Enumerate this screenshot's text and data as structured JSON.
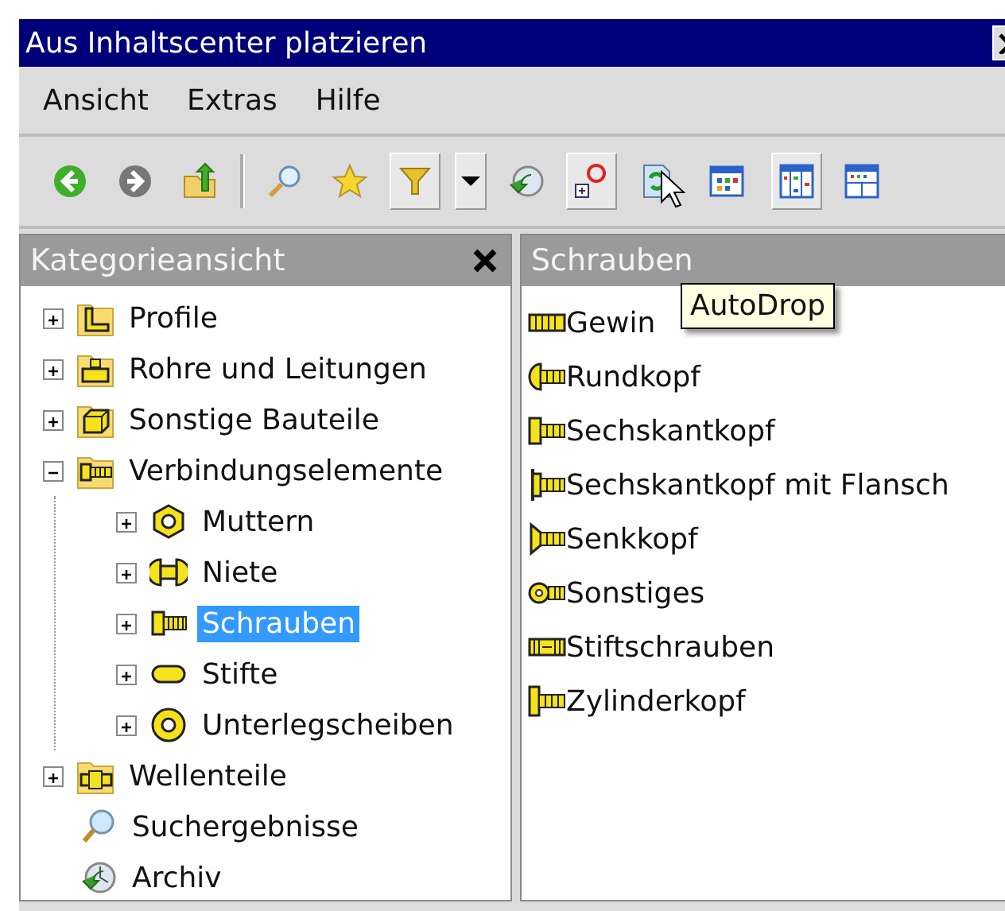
{
  "window": {
    "title": "Aus Inhaltscenter platzieren"
  },
  "menu": [
    "Ansicht",
    "Extras",
    "Hilfe"
  ],
  "toolbar": [
    {
      "pressed": false
    },
    {
      "pressed": false
    },
    {
      "pressed": false
    },
    {
      "kind": "separator"
    },
    {
      "pressed": false
    },
    {
      "pressed": false
    },
    {
      "pressed": true
    },
    {
      "pressed": true
    },
    {
      "pressed": false
    },
    {
      "pressed": true
    },
    {
      "pressed": false
    },
    {
      "pressed": false
    },
    {
      "pressed": true
    },
    {
      "pressed": false
    }
  ],
  "tooltip": "AutoDrop",
  "category_panel": {
    "title": "Kategorieansicht",
    "tree": [
      {
        "label": "Profile",
        "expanded": false,
        "selected": false
      },
      {
        "label": "Rohre und Leitungen",
        "expanded": false,
        "selected": false
      },
      {
        "label": "Sonstige Bauteile",
        "expanded": false,
        "selected": false
      },
      {
        "label": "Verbindungselemente",
        "expanded": true,
        "selected": false,
        "children": [
          {
            "label": "Muttern",
            "expanded": false,
            "selected": false
          },
          {
            "label": "Niete",
            "expanded": false,
            "selected": false
          },
          {
            "label": "Schrauben",
            "expanded": false,
            "selected": true
          },
          {
            "label": "Stifte",
            "expanded": false,
            "selected": false
          },
          {
            "label": "Unterlegscheiben",
            "expanded": false,
            "selected": false
          }
        ]
      },
      {
        "label": "Wellenteile",
        "expanded": false,
        "selected": false
      },
      {
        "label": "Suchergebnisse",
        "selected": false
      },
      {
        "label": "Archiv",
        "selected": false
      }
    ]
  },
  "content_panel": {
    "title": "Schrauben",
    "items": [
      "Gewin",
      "Rundkopf",
      "Sechskantkopf",
      "Sechskantkopf mit Flansch",
      "Senkkopf",
      "Sonstiges",
      "Stiftschrauben",
      "Zylinderkopf"
    ]
  }
}
